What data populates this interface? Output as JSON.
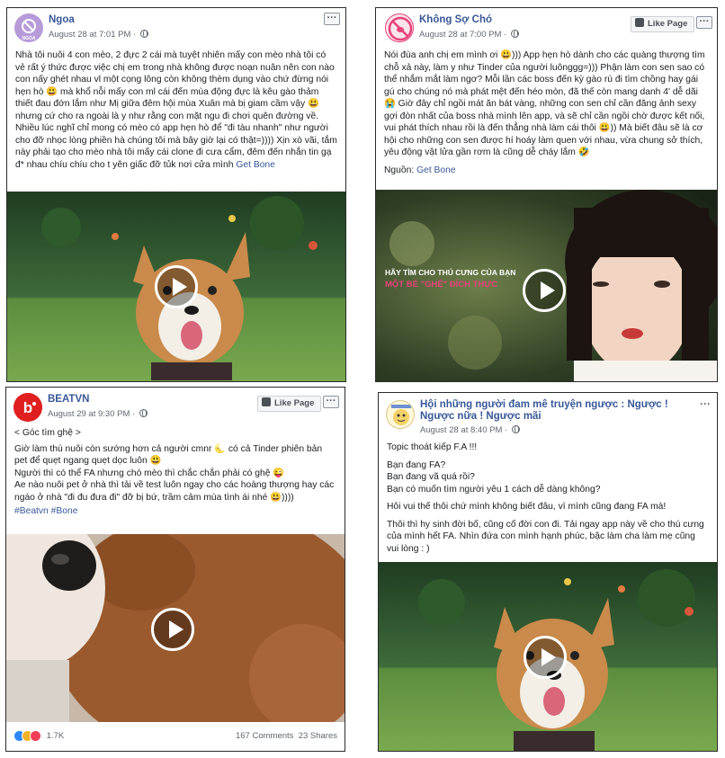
{
  "posts": [
    {
      "page_name": "Ngoa",
      "avatar_text": "NGOA",
      "timestamp": "August 28 at 7:01 PM",
      "more_label": "···",
      "body": [
        "Nhà tôi nuôi 4 con mèo, 2 đực 2 cái mà tuyệt nhiên mấy con mèo nhà tôi có vẻ rất ý thức được việc chị em trong nhà không được noạn nuân nên con nào con nấy ghét nhau vl một cọng lông còn không thèm dụng vào chứ đừng nói hẹn hò 😃 mà khổ nỗi mấy con ml cái đến mùa động đực là kêu gào thảm thiết đau đớn lắm như Mị giữa đêm hội mùa Xuân mà bị giam cầm vậy 😃 nhưng cứ cho ra ngoài là y như rằng con mặt ngu đi chơi quên đường về. Nhiều lúc nghĩ chỉ mong có mèo có app hẹn hò để \"đi tàu nhanh\" như người cho đỡ nhọc lòng phiền hà chúng tôi mà bây giờ lại có thật=)))) Xịn xò vãi, tắm này phải tạo cho mèo nhà tôi mấy cái clone đi cưa cẩm, đêm đến nhắn tin gạ đ* nhau chíu chíu cho t yên giấc đỡ tủk nơi cửa mình"
      ],
      "link": "Get Bone"
    },
    {
      "page_name": "Không Sợ Chó",
      "timestamp": "August 28 at 7:00 PM",
      "like_page_label": "Like Page",
      "more_label": "···",
      "body": [
        "Nói đùa anh chị em mình ơi 😃))) App hẹn hò dành cho các quàng thượng tìm chỗ xả này, làm y như Tinder của người luônggg=))) Phận làm con sen sao có thể nhắm mắt làm ngơ? Mỗi lần các boss đến kỳ gào rú đi tìm chồng hay gái gú cho chúng nó mà phát mệt đến héo mòn, đã thế còn mang danh 4' dễ dãi 😭 Giờ đây chỉ ngồi mát ăn bát vàng, những con sen chỉ cần đăng ảnh sexy gợi đòn nhất của boss nhà mình lên app, và sẽ chỉ cần ngồi chờ được kết nối, vui phát thích nhau rồi là đến thẳng nhà làm cái thôi 😃)) Mà biết đâu sẽ là cơ hội cho những con sen được hí hoáy làm quen với nhau, vừa chung sở thích, yêu động vật lửa gần rơm là cũng dễ cháy lắm 🤣"
      ],
      "source_label": "Nguồn: ",
      "link": "Get Bone",
      "video_caption_1": "HÃY TÌM CHO THÚ CƯNG CỦA BẠN",
      "video_caption_2": "MỘT BÉ \"GHỆ\" ĐÍCH THỰC"
    },
    {
      "page_name": "BEATVN",
      "timestamp": "August 29 at 9:30 PM",
      "like_page_label": "Like Page",
      "more_label": "···",
      "body": [
        "< Góc tìm ghệ >",
        "Giờ làm thú nuôi còn sướng hơn cả người cmnr 🌜 có cả Tinder phiên bản pet để quẹt ngang quẹt dọc luôn 😃",
        "Người thì có thể FA nhưng chó mèo thì chắc chắn phải có ghệ 😜",
        "Ae nào nuôi pet ở nhà thì tải về test luôn ngay cho các hoàng thượng hay các ngáo ở nhà \"đi đu đưa đi\" đỡ bị bứ, trầm cảm mùa tình ái nhé 😃))))"
      ],
      "hashtags": "#Beatvn #Bone",
      "reactions_count": "1.7K",
      "comments": "167 Comments",
      "shares": "23 Shares"
    },
    {
      "page_name": "Hội những người đam mê truyện ngược : Ngược ! Ngược nữa ! Ngược mãi",
      "timestamp": "August 28 at 8:40 PM",
      "more_label": "···",
      "body": [
        "Topic thoát kiếp F.A !!!",
        "Bạn đang FA?\nBạn đang vã quá rồi?\nBạn có muốn tìm người yêu 1 cách dễ dàng không?",
        "Hôi vui thế thôi chứ mình không biết đâu, vì mình cũng đang FA mà!",
        "Thôi thì hy sinh đời bố, cũng cố đời con đi. Tải ngay app này về cho thú cưng của mình hết FA. Nhìn đứa con mình hạnh phúc, bậc làm cha làm mẹ cũng vui lòng : )"
      ]
    }
  ],
  "colors": {
    "link": "#385898",
    "beat_red": "#e02020",
    "ngoa_purple": "#9c6fc7",
    "ksc_pink": "#e8417a"
  }
}
